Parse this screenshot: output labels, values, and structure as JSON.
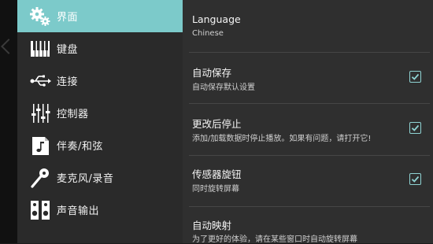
{
  "sidebar": {
    "items": [
      {
        "label": "界面",
        "icon": "gears-icon"
      },
      {
        "label": "键盘",
        "icon": "piano-keys-icon"
      },
      {
        "label": "连接",
        "icon": "usb-icon"
      },
      {
        "label": "控制器",
        "icon": "sliders-icon"
      },
      {
        "label": "伴奏/和弦",
        "icon": "music-note-icon"
      },
      {
        "label": "麦克风/录音",
        "icon": "microphone-icon"
      },
      {
        "label": "声音输出",
        "icon": "speakers-icon"
      }
    ]
  },
  "settings": {
    "language": {
      "title": "Language",
      "value": "Chinese"
    },
    "autosave": {
      "title": "自动保存",
      "subtitle": "自动保存默认设置",
      "checked": true
    },
    "stop_after_change": {
      "title": "更改后停止",
      "subtitle": "添加/加载数据时停止播放。如果有问题，请打开它!",
      "checked": true
    },
    "sensor_knob": {
      "title": "传感器旋钮",
      "subtitle": "同时旋转屏幕",
      "checked": true
    },
    "auto_mapping": {
      "title": "自动映射",
      "subtitle": "为了更好的体验，请在某些窗口时自动旋转屏幕"
    }
  },
  "colors": {
    "accent": "#7ccaca",
    "checkbox": "#8fd3d3"
  }
}
